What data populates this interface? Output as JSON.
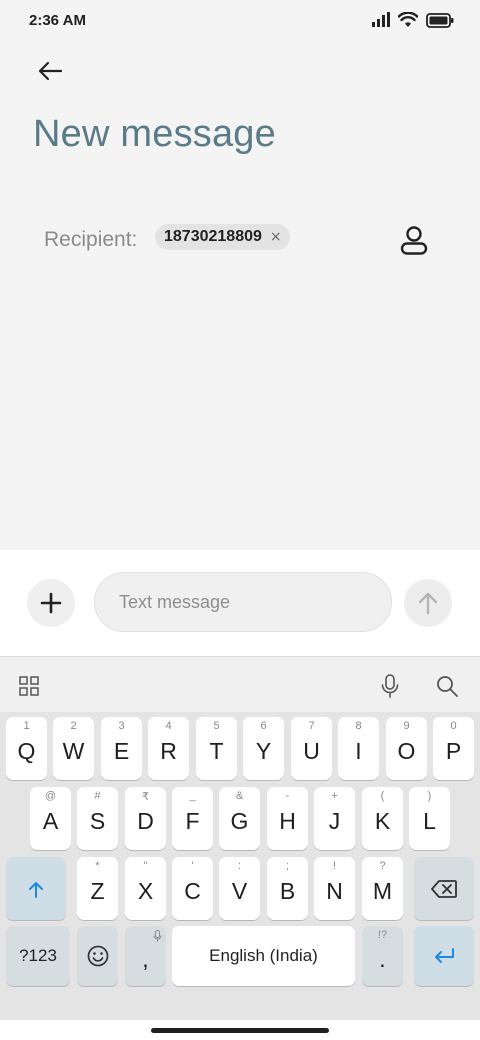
{
  "status": {
    "time": "2:36 AM",
    "icons": [
      "signal-icon",
      "wifi-icon",
      "battery-icon"
    ]
  },
  "header": {
    "back_icon": "arrow-left-icon",
    "title": "New message"
  },
  "recipient": {
    "label": "Recipient:",
    "chip_text": "18730218809",
    "chip_close": "×",
    "contact_icon": "person-icon"
  },
  "composer": {
    "add_icon": "plus-icon",
    "placeholder": "Text message",
    "send_icon": "arrow-up-icon"
  },
  "keyboard_toolbar": {
    "icons": [
      "grid-icon",
      "mic-icon",
      "search-icon"
    ]
  },
  "keyboard": {
    "row1": [
      {
        "key": "Q",
        "hint": "1"
      },
      {
        "key": "W",
        "hint": "2"
      },
      {
        "key": "E",
        "hint": "3"
      },
      {
        "key": "R",
        "hint": "4"
      },
      {
        "key": "T",
        "hint": "5"
      },
      {
        "key": "Y",
        "hint": "6"
      },
      {
        "key": "U",
        "hint": "7"
      },
      {
        "key": "I",
        "hint": "8"
      },
      {
        "key": "O",
        "hint": "9"
      },
      {
        "key": "P",
        "hint": "0"
      }
    ],
    "row2": [
      {
        "key": "A",
        "hint": "@"
      },
      {
        "key": "S",
        "hint": "#"
      },
      {
        "key": "D",
        "hint": "₹"
      },
      {
        "key": "F",
        "hint": "_"
      },
      {
        "key": "G",
        "hint": "&"
      },
      {
        "key": "H",
        "hint": "-"
      },
      {
        "key": "J",
        "hint": "+"
      },
      {
        "key": "K",
        "hint": "("
      },
      {
        "key": "L",
        "hint": ")"
      }
    ],
    "row3": [
      {
        "key": "Z",
        "hint": "*"
      },
      {
        "key": "X",
        "hint": "\""
      },
      {
        "key": "C",
        "hint": "'"
      },
      {
        "key": "V",
        "hint": ":"
      },
      {
        "key": "B",
        "hint": ";"
      },
      {
        "key": "N",
        "hint": "!"
      },
      {
        "key": "M",
        "hint": "?"
      }
    ],
    "shift_icon": "shift-arrow-icon",
    "backspace_icon": "backspace-icon",
    "symbols_label": "?123",
    "emoji_icon": "smiley-icon",
    "comma_label": ",",
    "space_label": "English (India)",
    "period_label": ".",
    "period_hint": "!?",
    "enter_icon": "enter-icon"
  },
  "colors": {
    "title": "#5a7b88",
    "accent": "#1e88e5"
  }
}
